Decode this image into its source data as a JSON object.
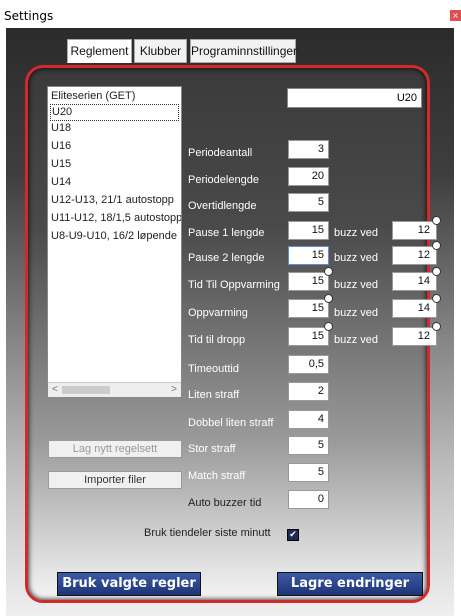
{
  "window": {
    "title": "Settings",
    "close_glyph": "×"
  },
  "tabs": [
    {
      "label": "Reglement",
      "active": true
    },
    {
      "label": "Klubber",
      "active": false
    },
    {
      "label": "Programinnstillinger",
      "active": false
    }
  ],
  "rulesets": {
    "items": [
      "Eliteserien (GET)",
      "U20",
      "U18",
      "U16",
      "U15",
      "U14",
      "U12-U13, 21/1 autostopp",
      "U11-U12, 18/1,5 autostopp",
      "U8-U9-U10, 16/2 løpende"
    ],
    "selected": "U20"
  },
  "ruleset_name": "U20",
  "settings": [
    {
      "label": "Periodeantall",
      "value": "3"
    },
    {
      "label": "Periodelengde",
      "value": "20"
    },
    {
      "label": "Overtidlengde",
      "value": "5"
    },
    {
      "label": "Pause 1 lengde",
      "value": "15",
      "buzz_label": "buzz ved",
      "buzz_value": "12"
    },
    {
      "label": "Pause 2 lengde",
      "value": "15",
      "buzz_label": "buzz ved",
      "buzz_value": "12"
    },
    {
      "label": "Tid Til Oppvarming",
      "value": "15",
      "buzz_label": "buzz ved",
      "buzz_value": "14"
    },
    {
      "label": "Oppvarming",
      "value": "15",
      "buzz_label": "buzz ved",
      "buzz_value": "14"
    },
    {
      "label": "Tid til dropp",
      "value": "15",
      "buzz_label": "buzz ved",
      "buzz_value": "12"
    },
    {
      "label": "Timeouttid",
      "value": "0,5"
    },
    {
      "label": "Liten straff",
      "value": "2"
    },
    {
      "label": "Dobbel liten straff",
      "value": "4"
    },
    {
      "label": "Stor straff",
      "value": "5"
    },
    {
      "label": "Match straff",
      "value": "5"
    },
    {
      "label": "Auto buzzer tid",
      "value": "0"
    }
  ],
  "buttons": {
    "new_ruleset": "Lag nytt regelsett",
    "import_files": "Importer filer",
    "apply": "Bruk valgte regler",
    "save": "Lagre endringer"
  },
  "tenths_checkbox": {
    "label": "Bruk tiendeler siste minutt",
    "checked": true
  },
  "colors": {
    "frame_border": "#d02a2a",
    "button_blue": "#2a4590",
    "close_red": "#e24d4d"
  },
  "icons": {
    "close": "close-icon",
    "check": "checkmark-icon"
  }
}
